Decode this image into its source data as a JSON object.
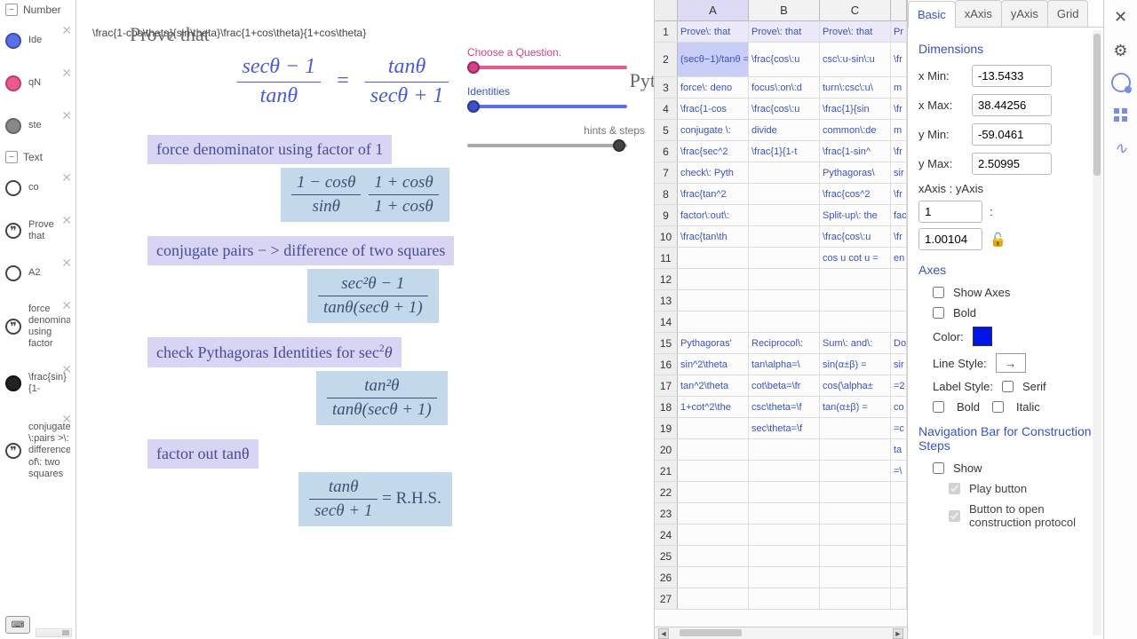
{
  "algebra": {
    "section_number": "Number",
    "section_text": "Text",
    "items": [
      {
        "label": "Ide"
      },
      {
        "label": "qN"
      },
      {
        "label": "ste"
      },
      {
        "label": "co"
      },
      {
        "label": "Prove that"
      },
      {
        "label": "A2"
      },
      {
        "label": "force denominator using factor"
      },
      {
        "label": "\\frac{sin}{1-"
      },
      {
        "label": "conjugate \\:pairs >\\: difference of\\: two squares"
      }
    ]
  },
  "graphics": {
    "formula_bar": "\\frac{1-cos\\theta}{sin\\theta}\\frac{1+cos\\theta}{1+cos\\theta}",
    "title": "Prove that",
    "main_lhs_num": "secθ − 1",
    "main_lhs_den": "tanθ",
    "main_rhs_num": "tanθ",
    "main_rhs_den": "secθ + 1",
    "step1_label": "force denominator using factor of 1",
    "step1_f1_num": "1 − cosθ",
    "step1_f1_den": "sinθ",
    "step1_f2_num": "1 + cosθ",
    "step1_f2_den": "1 + cosθ",
    "step2_label": "conjugate pairs − >  difference of two squares",
    "step2_num": "sec²θ − 1",
    "step2_den": "tanθ(secθ + 1)",
    "step3_label_pre": "check Pythagoras Identities for sec",
    "step3_label_post": "θ",
    "step3_num": "tan²θ",
    "step3_den": "tanθ(secθ + 1)",
    "step4_label": "factor out tanθ",
    "step4_num": "tanθ",
    "step4_den": "secθ + 1",
    "step4_rhs": " = R.H.S.",
    "slider1_caption": "Choose a Question.",
    "slider2_caption": "Identities",
    "slider3_caption": "hints & steps",
    "edge_text": "Pyt"
  },
  "spreadsheet": {
    "cols": [
      "A",
      "B",
      "C"
    ],
    "rows": [
      [
        "Prove\\: that",
        "Prove\\: that",
        "Prove\\: that",
        "Pr"
      ],
      [
        "(secθ−1)/tanθ =",
        "\\frac{cos\\:u",
        "csc\\:u-sin\\:u",
        "\\fr"
      ],
      [
        "force\\: deno",
        "focus\\:on\\:d",
        "turn\\:csc\\:u\\",
        "m"
      ],
      [
        "\\frac{1-cos",
        "\\frac{cos\\:u",
        "\\frac{1}{sin",
        "\\fr"
      ],
      [
        "conjugate \\:",
        "divide",
        "common\\:de",
        "m"
      ],
      [
        "\\frac{sec^2",
        "\\frac{1}{1-t",
        "\\frac{1-sin^",
        "\\fr"
      ],
      [
        "check\\: Pyth",
        "",
        "Pythagoras\\",
        "sir"
      ],
      [
        "\\frac{tan^2",
        "",
        "\\frac{cos^2",
        "\\fr"
      ],
      [
        "factor\\:out\\:",
        "",
        "Split-up\\: the",
        "fac"
      ],
      [
        "\\frac{tan\\th",
        "",
        "\\frac{cos\\:u",
        "\\fr"
      ],
      [
        "",
        "",
        "cos u cot u =",
        "en"
      ],
      [
        "",
        "",
        "",
        ""
      ],
      [
        "",
        "",
        "",
        ""
      ],
      [
        "",
        "",
        "",
        ""
      ],
      [
        "Pythagoras'",
        "Reciprocol\\:",
        "Sum\\: and\\:",
        "Do"
      ],
      [
        "sin^2\\theta",
        "tan\\alpha=\\",
        "sin(α±β) =",
        "sir"
      ],
      [
        "tan^2\\theta",
        "cot\\beta=\\fr",
        "cos(\\alpha±",
        "=2"
      ],
      [
        "1+cot^2\\the",
        "csc\\theta=\\f",
        "tan(α±β) =",
        "co"
      ],
      [
        "",
        "sec\\theta=\\f",
        "",
        "=c"
      ],
      [
        "",
        "",
        "",
        "ta"
      ],
      [
        "",
        "",
        "",
        "=\\"
      ],
      [
        "",
        "",
        "",
        ""
      ],
      [
        "",
        "",
        "",
        ""
      ],
      [
        "",
        "",
        "",
        ""
      ],
      [
        "",
        "",
        "",
        ""
      ],
      [
        "",
        "",
        "",
        ""
      ],
      [
        "",
        "",
        "",
        ""
      ]
    ]
  },
  "settings": {
    "tabs": [
      "Basic",
      "xAxis",
      "yAxis",
      "Grid"
    ],
    "dimensions_title": "Dimensions",
    "xmin_label": "x Min:",
    "xmin": "-13.5433",
    "xmax_label": "x Max:",
    "xmax": "38.44256",
    "ymin_label": "y Min:",
    "ymin": "-59.0461",
    "ymax_label": "y Max:",
    "ymax": "2.50995",
    "ratio_label": "xAxis : yAxis",
    "ratio_x": "1",
    "ratio_y": "1.00104",
    "axes_title": "Axes",
    "show_axes": "Show Axes",
    "bold": "Bold",
    "color_label": "Color:",
    "line_style_label": "Line Style:",
    "label_style_label": "Label Style:",
    "serif": "Serif",
    "italic": "Italic",
    "nav_title": "Navigation Bar for Construction Steps",
    "show": "Show",
    "play": "Play button",
    "open_protocol": "Button to open construction protocol"
  },
  "toolbar": {
    "close": "✕",
    "gear": "⚙"
  }
}
